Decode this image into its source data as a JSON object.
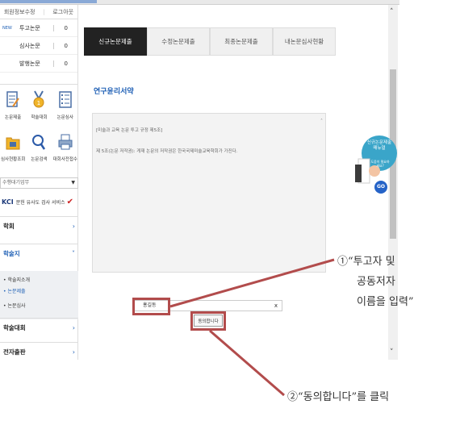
{
  "sidebar": {
    "top_links": [
      "회원정보수정",
      "로그아웃"
    ],
    "counts": [
      {
        "new": "NEW",
        "label": "투고논문",
        "value": "0"
      },
      {
        "new": "",
        "label": "심사논문",
        "value": "0"
      },
      {
        "new": "",
        "label": "발행논문",
        "value": "0"
      }
    ],
    "icons": [
      {
        "icon": "document-edit-icon",
        "label": "논문제출"
      },
      {
        "icon": "medal-icon",
        "label": "학술대회"
      },
      {
        "icon": "list-icon",
        "label": "논문심사"
      },
      {
        "icon": "folder-icon",
        "label": "심사현황조회"
      },
      {
        "icon": "search-icon",
        "label": "논문검색"
      },
      {
        "icon": "printer-icon",
        "label": "대회사전접수"
      }
    ],
    "select_value": "수행대기업무",
    "kci_prefix": "KCI",
    "kci_label": "문헌 유사도 검사 서비스",
    "menu": [
      {
        "label": "학회",
        "active": false
      },
      {
        "label": "학술지",
        "active": true
      },
      {
        "label": "학술대회",
        "active": false
      },
      {
        "label": "전자출판",
        "active": false
      }
    ],
    "sub_items": [
      {
        "label": "• 학술지소개",
        "active": false
      },
      {
        "label": "• 논문제출",
        "active": true
      },
      {
        "label": "• 논문심사",
        "active": false
      }
    ]
  },
  "tabs": [
    "신규논문제출",
    "수정논문제출",
    "최종논문제출",
    "내논문심사현황"
  ],
  "active_tab": 0,
  "page_title": "연구윤리서약",
  "agreement_text": [
    "[미술과 교육 논문 투고 규정 제5조]",
    "제 5조(논문 저작권): 게재 논문의 저작권은 한국국제미술교육학회가 가진다."
  ],
  "name_input": {
    "value": "홍길동"
  },
  "agree_button": "동의합니다",
  "banner": {
    "title": "신규논문제출 매뉴얼",
    "sub": "도움이 필요하세요?",
    "go": "GO"
  },
  "annotations": {
    "callout1": [
      "①“투고자  및",
      "공동저자",
      "이름을  입력”"
    ],
    "callout2": "②“동의합니다”를  클릭"
  },
  "colors": {
    "accent_blue": "#1e5fb5",
    "highlight_red": "#b24c4c",
    "active_tab": "#222222"
  }
}
